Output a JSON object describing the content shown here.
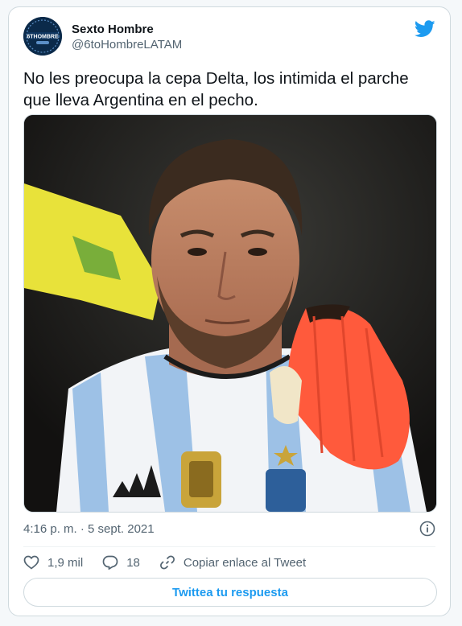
{
  "author": {
    "name": "Sexto Hombre",
    "handle": "@6toHombreLATAM",
    "avatar_icon": "sexto-hombre-logo"
  },
  "tweet": {
    "text": "No les preocupa la cepa Delta, los intimida el parche que lleva Argentina en el pecho.",
    "timestamp": "4:16 p. m. · 5 sept. 2021"
  },
  "media": {
    "icon": "photo-soccer-player"
  },
  "actions": {
    "likes": "1,9 mil",
    "replies": "18",
    "copy_link": "Copiar enlace al Tweet"
  },
  "reply_button": "Twittea tu respuesta",
  "colors": {
    "accent": "#1d9bf0",
    "muted": "#536471",
    "text": "#0f1419"
  }
}
